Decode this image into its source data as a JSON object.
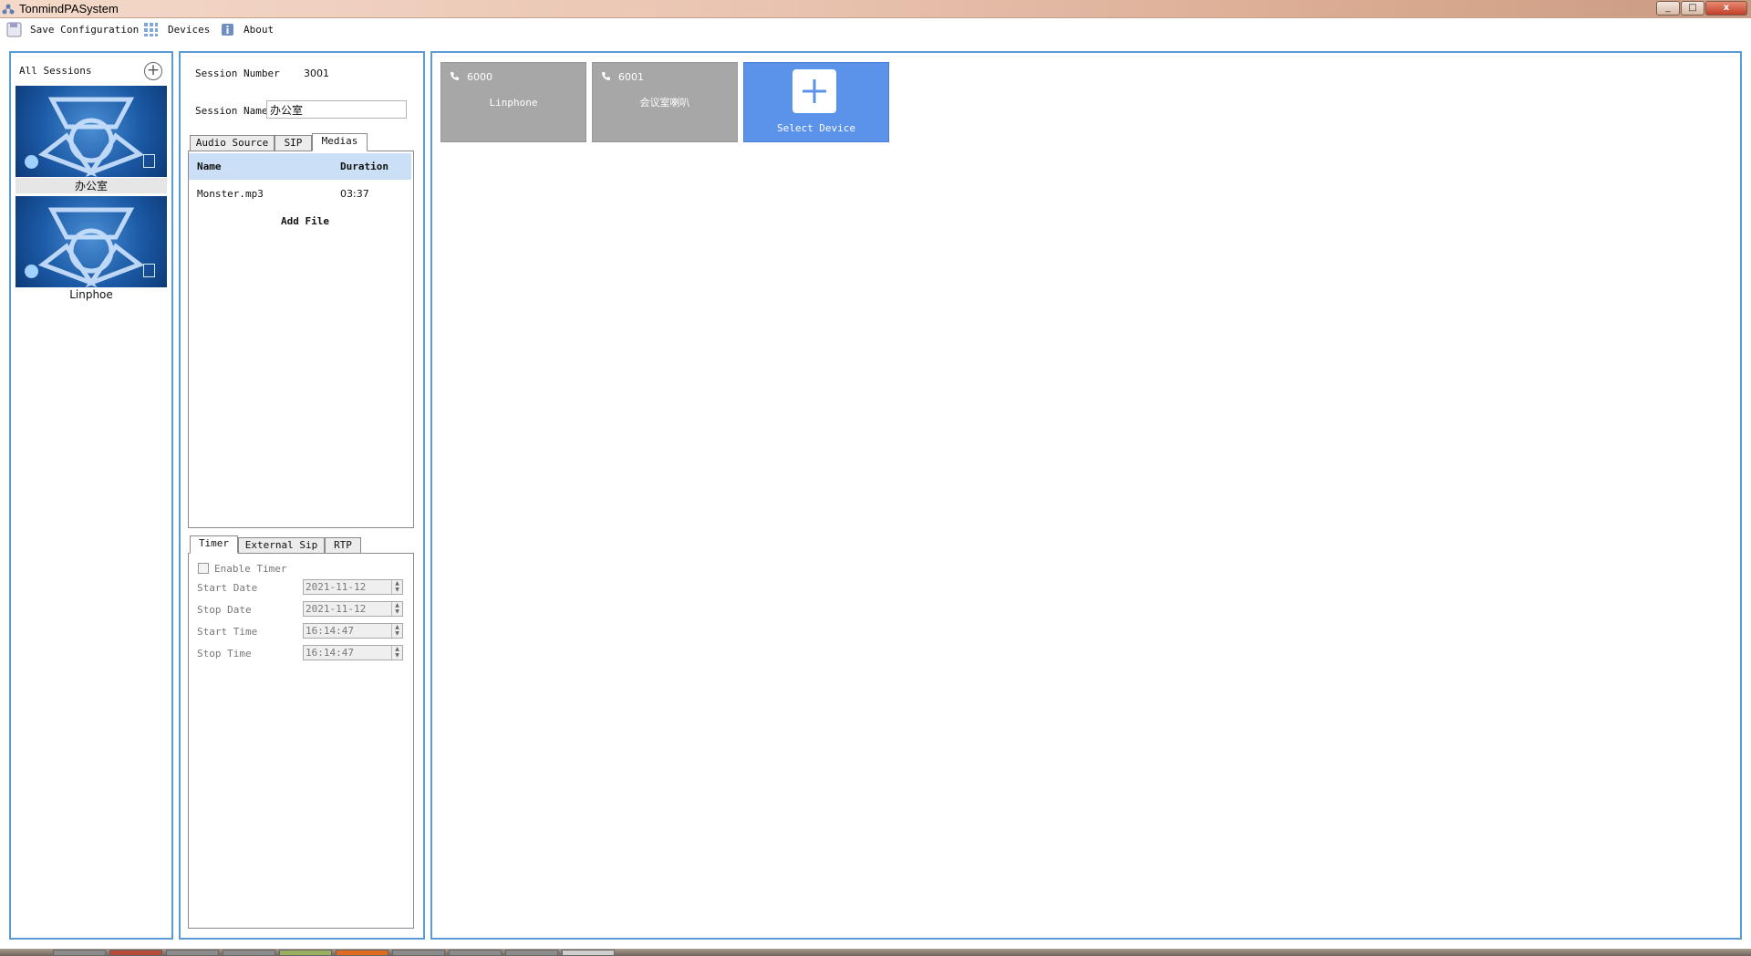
{
  "window": {
    "title": "TonmindPASystem",
    "min": "_",
    "max": "□",
    "close": "x"
  },
  "menu": {
    "save": "Save Configuration",
    "devices": "Devices",
    "about": "About"
  },
  "sessions": {
    "title": "All Sessions",
    "items": [
      {
        "label": "办公室"
      },
      {
        "label": "Linphoe"
      }
    ]
  },
  "form": {
    "session_number_label": "Session Number",
    "session_number_value": "3001",
    "session_name_label": "Session Name",
    "session_name_value": "办公室"
  },
  "tabs_top": [
    {
      "label": "Audio Source"
    },
    {
      "label": "SIP"
    },
    {
      "label": "Medias"
    }
  ],
  "media": {
    "columns": [
      "Name",
      "Duration"
    ],
    "rows": [
      {
        "name": "Monster.mp3",
        "duration": "03:37"
      }
    ],
    "add_file": "Add File"
  },
  "tabs_bottom": [
    {
      "label": "Timer"
    },
    {
      "label": "External Sip"
    },
    {
      "label": "RTP"
    }
  ],
  "timer": {
    "enable_label": "Enable Timer",
    "start_date_label": "Start Date",
    "start_date": "2021-11-12",
    "stop_date_label": "Stop Date",
    "stop_date": "2021-11-12",
    "start_time_label": "Start Time",
    "start_time": "16:14:47",
    "stop_time_label": "Stop Time",
    "stop_time": "16:14:47"
  },
  "devices": [
    {
      "number": "6000",
      "name": "Linphone"
    },
    {
      "number": "6001",
      "name": "会议室喇叭"
    }
  ],
  "select_device": "Select Device",
  "colors": {
    "panel_border": "#5b9bd5",
    "accent": "#5b92ea",
    "device_card": "#a7a7a7",
    "selected_header": "#cbe0f7"
  }
}
